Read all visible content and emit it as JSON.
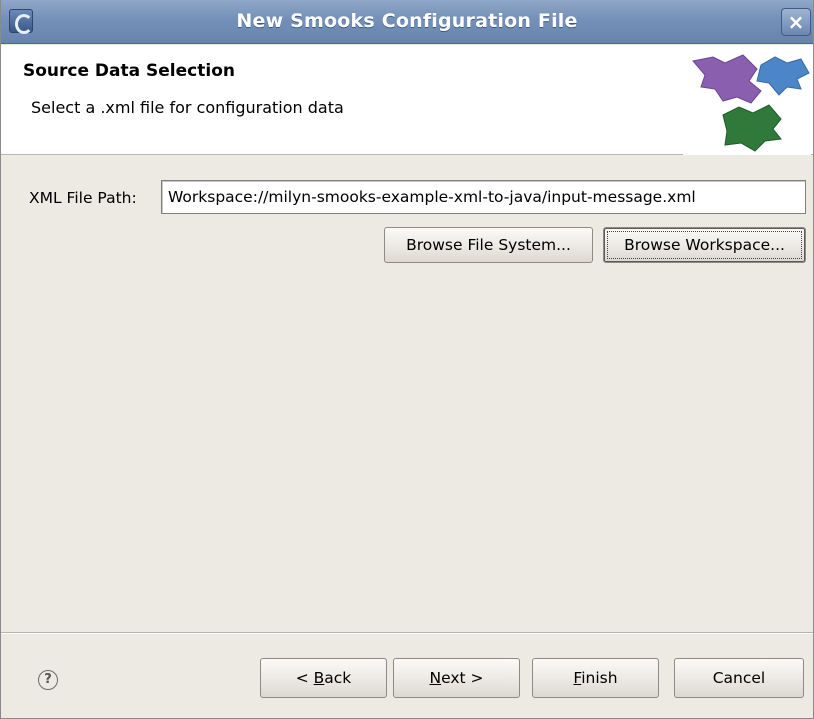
{
  "window": {
    "title": "New Smooks Configuration File",
    "close_glyph": "×"
  },
  "header": {
    "title": "Source Data Selection",
    "description": "Select a .xml file for configuration data"
  },
  "form": {
    "xml_path_label": "XML File Path:",
    "xml_path_value": "Workspace://milyn-smooks-example-xml-to-java/input-message.xml",
    "browse_file_system_label": "Browse File System...",
    "browse_workspace_label": "Browse Workspace..."
  },
  "footer": {
    "help_glyph": "?",
    "back": {
      "prefix": "< ",
      "mnemonic": "B",
      "rest": "ack"
    },
    "next": {
      "prefix": "",
      "mnemonic": "N",
      "rest": "ext >"
    },
    "finish": {
      "prefix": "",
      "mnemonic": "F",
      "rest": "inish"
    },
    "cancel_label": "Cancel"
  },
  "colors": {
    "titlebar": "#7490b8",
    "background": "#ede9e3",
    "logo_purple": "#8a5fb0",
    "logo_blue": "#4d86c8",
    "logo_green": "#2f7a3a"
  },
  "icons": [
    "eclipse-app-icon",
    "close-icon",
    "wizard-banner-logo",
    "help-icon"
  ]
}
